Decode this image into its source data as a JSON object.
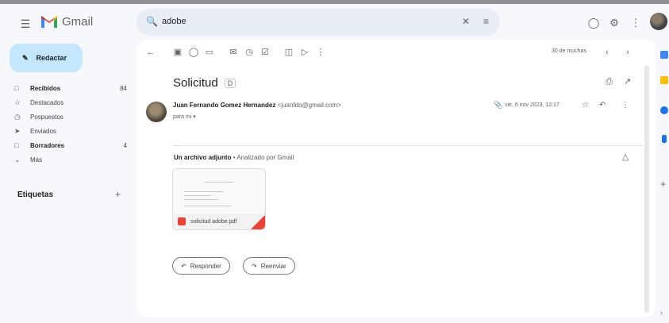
{
  "header": {
    "brand": "Gmail",
    "search_query": "adobe",
    "icons": [
      "menu-icon",
      "search-icon",
      "clear-icon",
      "tune-icon",
      "help-icon",
      "settings-icon",
      "apps-icon"
    ]
  },
  "compose": {
    "label": "Redactar"
  },
  "sidebar": {
    "items": [
      {
        "label": "Recibidos",
        "count": "84",
        "icon": "inbox-icon",
        "bold": true
      },
      {
        "label": "Destacados",
        "count": "",
        "icon": "star-icon",
        "bold": false
      },
      {
        "label": "Pospuestos",
        "count": "",
        "icon": "clock-icon",
        "bold": false
      },
      {
        "label": "Enviados",
        "count": "",
        "icon": "send-icon",
        "bold": false
      },
      {
        "label": "Borradores",
        "count": "4",
        "icon": "draft-icon",
        "bold": true
      },
      {
        "label": "Más",
        "count": "",
        "icon": "chevron-down-icon",
        "bold": false
      }
    ],
    "labels_heading": "Etiquetas"
  },
  "toolbar": {
    "pager": "30 de muchas"
  },
  "message": {
    "subject": "Solicitud",
    "tag": "D",
    "sender_name": "Juan Fernando Gomez Hernandez",
    "sender_email": "<juanfdo@gmail.com>",
    "to": "para mi",
    "date": "vie, 6 nov 2023, 12:17",
    "attachment_heading": "Un archivo adjunto",
    "attachment_sub": "• Analizado por Gmail",
    "attachment_name": "solicitud adobe.pdf"
  },
  "actions": {
    "reply": "Responder",
    "forward": "Reenviar"
  },
  "colors": {
    "accent": "#c2e7ff",
    "pdf": "#ea4335"
  }
}
